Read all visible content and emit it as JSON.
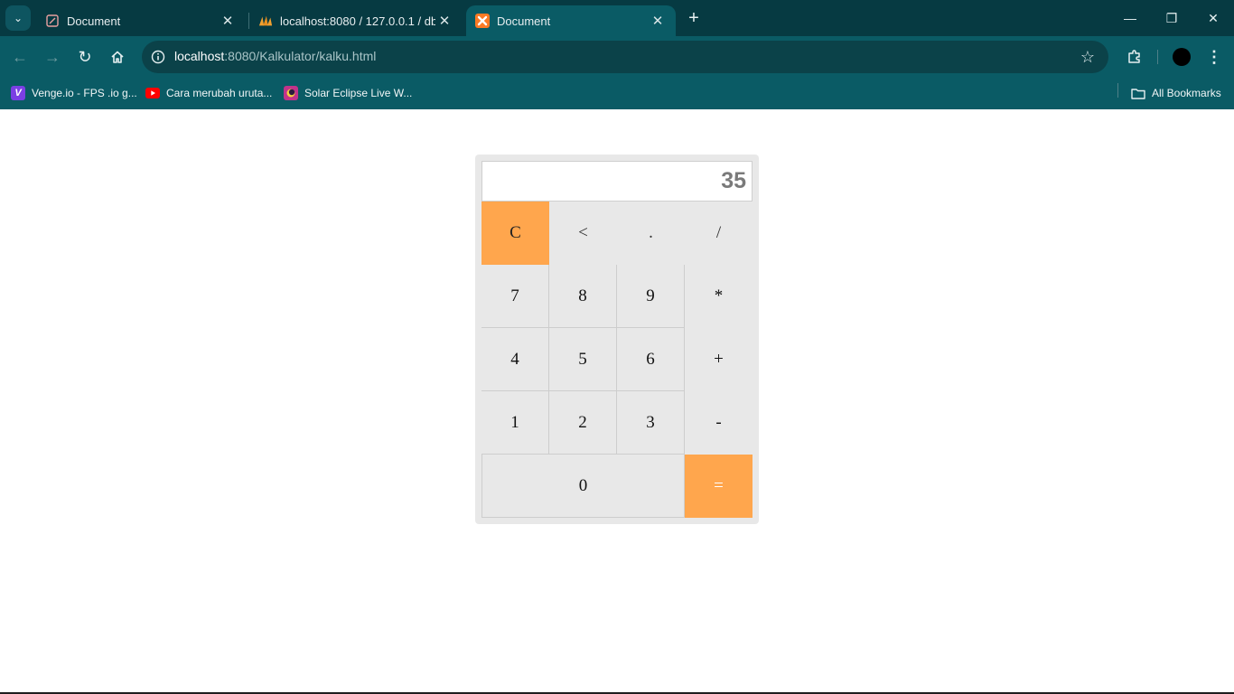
{
  "browser": {
    "tabs": [
      {
        "title": "Document",
        "icon": "document-icon"
      },
      {
        "title": "localhost:8080 / 127.0.0.1 / db_",
        "icon": "phpmyadmin-icon"
      },
      {
        "title": "Document",
        "icon": "xampp-icon",
        "active": true
      }
    ],
    "omnibox": {
      "host": "localhost",
      "rest": ":8080/Kalkulator/kalku.html"
    },
    "bookmarks": [
      {
        "label": "Venge.io - FPS .io g...",
        "icon": "venge-icon",
        "color": "#7b3fe4"
      },
      {
        "label": "Cara merubah uruta...",
        "icon": "youtube-icon",
        "color": "#ff0000"
      },
      {
        "label": "Solar Eclipse Live W...",
        "icon": "game-icon",
        "color": "#c2328a"
      }
    ],
    "all_bookmarks_label": "All Bookmarks"
  },
  "calculator": {
    "display": "35",
    "keys": {
      "clear": "C",
      "backspace": "<",
      "dot": ".",
      "divide": "/",
      "seven": "7",
      "eight": "8",
      "nine": "9",
      "multiply": "*",
      "four": "4",
      "five": "5",
      "six": "6",
      "plus": "+",
      "one": "1",
      "two": "2",
      "three": "3",
      "minus": "-",
      "zero": "0",
      "equals": "="
    },
    "colors": {
      "accent": "#ffa64d",
      "key_bg": "#e8e8e8"
    }
  }
}
